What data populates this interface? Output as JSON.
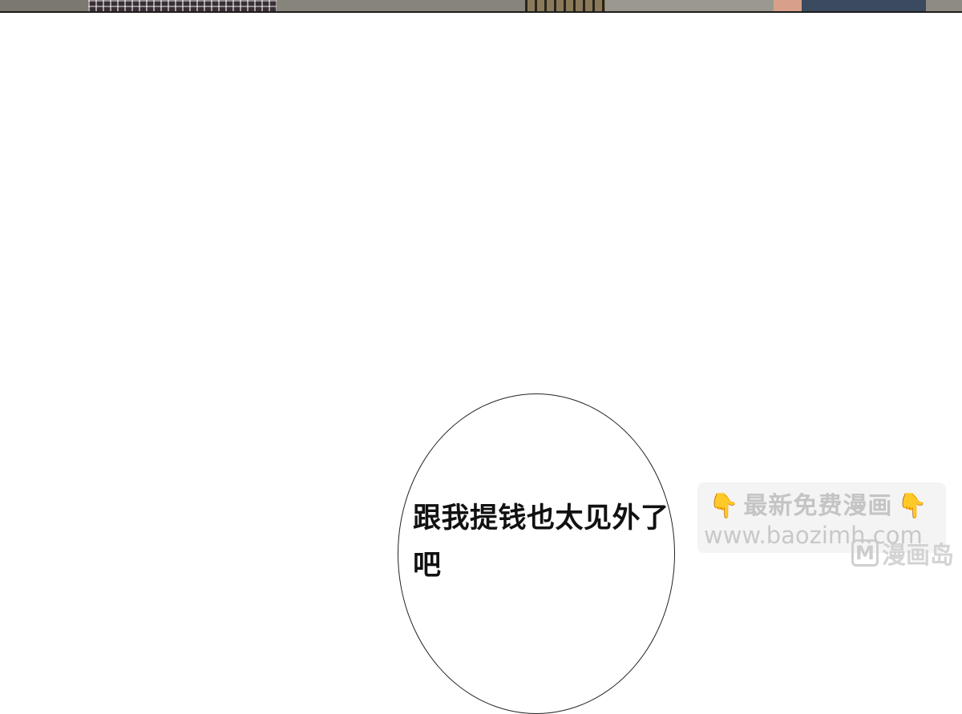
{
  "speech": {
    "text": "跟我提钱也太见外了吧"
  },
  "watermark": {
    "title": "最新免费漫画",
    "url": "www.baozimh.com",
    "icon_left": "pointing-down-hand-icon",
    "icon_right": "pointing-down-hand-icon"
  },
  "brand": {
    "mark": "M",
    "name": "漫画岛"
  },
  "colors": {
    "background": "#ffffff",
    "bubble_stroke": "#222222",
    "hand_icon": "#f5c242",
    "watermark_text": "#b4b4b4"
  }
}
